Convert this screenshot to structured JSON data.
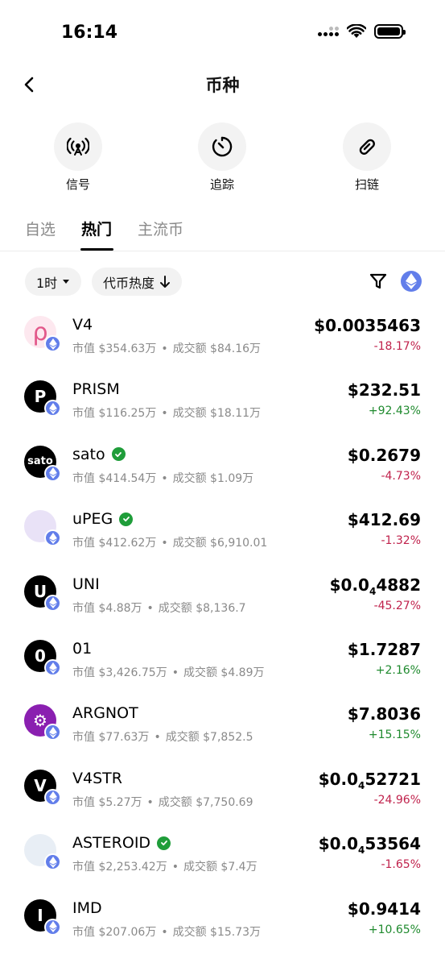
{
  "status_bar": {
    "time": "16:14"
  },
  "nav": {
    "title": "币种"
  },
  "actions": [
    {
      "label": "信号",
      "icon": "broadcast-icon"
    },
    {
      "label": "追踪",
      "icon": "timer-icon"
    },
    {
      "label": "扫链",
      "icon": "link-icon"
    }
  ],
  "tabs": [
    {
      "label": "自选",
      "active": false
    },
    {
      "label": "热门",
      "active": true
    },
    {
      "label": "主流币",
      "active": false
    }
  ],
  "filters": {
    "timeframe": "1时",
    "sort": "代币热度"
  },
  "colors": {
    "eth": "#627eea",
    "down": "#c0224c",
    "up": "#1f8a2e",
    "verified": "#1f9d3a"
  },
  "tokens": [
    {
      "name": "V4",
      "verified": false,
      "market_cap": "市值 $354.63万",
      "volume": "成交额 $84.16万",
      "price": "$0.0035463",
      "change": "-18.17%",
      "direction": "down",
      "avatar_text": "ρ",
      "avatar_bg": "#fde8ef",
      "avatar_fg": "#e2588a"
    },
    {
      "name": "PRISM",
      "verified": false,
      "market_cap": "市值 $116.25万",
      "volume": "成交额 $18.11万",
      "price": "$232.51",
      "change": "+92.43%",
      "direction": "up",
      "avatar_text": "P",
      "avatar_bg": "#000000",
      "avatar_fg": "#ffffff"
    },
    {
      "name": "sato",
      "verified": true,
      "market_cap": "市值 $414.54万",
      "volume": "成交额 $1.09万",
      "price": "$0.2679",
      "change": "-4.73%",
      "direction": "down",
      "avatar_text": "sato",
      "avatar_bg": "#000000",
      "avatar_fg": "#ffffff"
    },
    {
      "name": "uPEG",
      "verified": true,
      "market_cap": "市值 $412.62万",
      "volume": "成交额 $6,910.01",
      "price": "$412.69",
      "change": "-1.32%",
      "direction": "down",
      "avatar_text": "",
      "avatar_bg": "#e9e2f7",
      "avatar_fg": "#e46bb5"
    },
    {
      "name": "UNI",
      "verified": false,
      "market_cap": "市值 $4.88万",
      "volume": "成交额 $8,136.7",
      "price_main": "$0.0",
      "price_sub": "4",
      "price_rest": "4882",
      "change": "-45.27%",
      "direction": "down",
      "avatar_text": "U",
      "avatar_bg": "#000000",
      "avatar_fg": "#ffffff"
    },
    {
      "name": "01",
      "verified": false,
      "market_cap": "市值 $3,426.75万",
      "volume": "成交额 $4.89万",
      "price": "$1.7287",
      "change": "+2.16%",
      "direction": "up",
      "avatar_text": "0",
      "avatar_bg": "#000000",
      "avatar_fg": "#ffffff"
    },
    {
      "name": "ARGNOT",
      "verified": false,
      "market_cap": "市值 $77.63万",
      "volume": "成交额 $7,852.5",
      "price": "$7.8036",
      "change": "+15.15%",
      "direction": "up",
      "avatar_text": "⚙",
      "avatar_bg": "#8a1fb0",
      "avatar_fg": "#ffffff"
    },
    {
      "name": "V4STR",
      "verified": false,
      "market_cap": "市值 $5.27万",
      "volume": "成交额 $7,750.69",
      "price_main": "$0.0",
      "price_sub": "4",
      "price_rest": "52721",
      "change": "-24.96%",
      "direction": "down",
      "avatar_text": "V",
      "avatar_bg": "#000000",
      "avatar_fg": "#ffffff"
    },
    {
      "name": "ASTEROID",
      "verified": true,
      "market_cap": "市值 $2,253.42万",
      "volume": "成交额 $7.4万",
      "price_main": "$0.0",
      "price_sub": "4",
      "price_rest": "53564",
      "change": "-1.65%",
      "direction": "down",
      "avatar_text": "",
      "avatar_bg": "#e8eef5",
      "avatar_fg": "#d98a3a"
    },
    {
      "name": "IMD",
      "verified": false,
      "market_cap": "市值 $207.06万",
      "volume": "成交额 $15.73万",
      "price": "$0.9414",
      "change": "+10.65%",
      "direction": "up",
      "avatar_text": "I",
      "avatar_bg": "#000000",
      "avatar_fg": "#ffffff"
    }
  ]
}
